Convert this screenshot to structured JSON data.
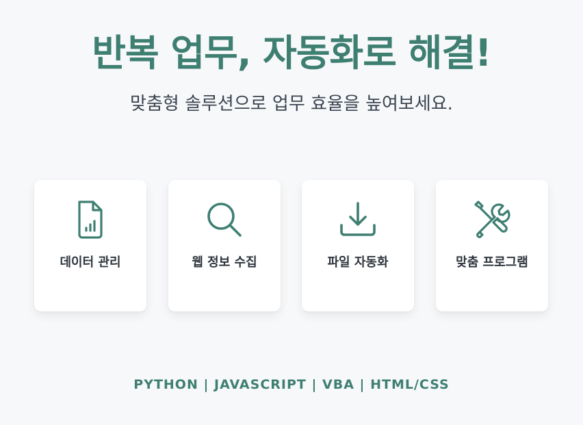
{
  "hero": {
    "title": "반복 업무, 자동화로 해결!",
    "subtitle": "맞춤형 솔루션으로 업무 효율을 높여보세요."
  },
  "services": [
    {
      "label": "데이터 관리",
      "icon": "file-chart-icon"
    },
    {
      "label": "웹 정보 수집",
      "icon": "search-icon"
    },
    {
      "label": "파일 자동화",
      "icon": "download-icon"
    },
    {
      "label": "맞춤 프로그램",
      "icon": "tools-icon"
    }
  ],
  "tech_stack": "PYTHON | JAVASCRIPT | VBA | HTML/CSS",
  "colors": {
    "accent": "#3e7f72",
    "background": "#f7f8fa",
    "card": "#ffffff",
    "text": "#2f353d"
  }
}
